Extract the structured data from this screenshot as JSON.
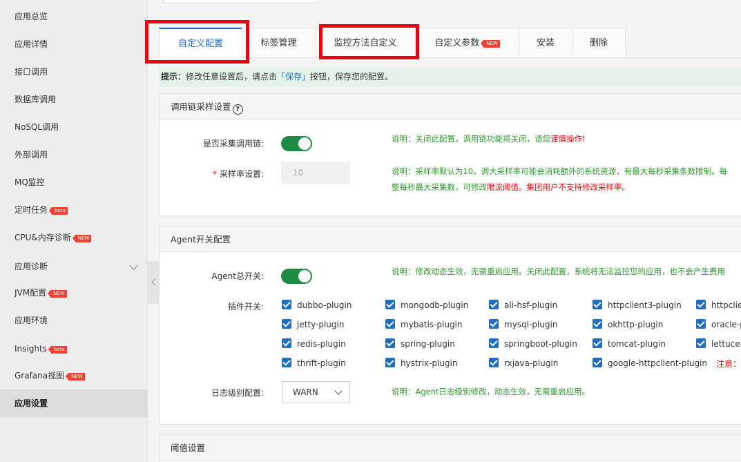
{
  "sidebar": {
    "items": [
      {
        "label": "应用总览"
      },
      {
        "label": "应用详情"
      },
      {
        "label": "接口调用"
      },
      {
        "label": "数据库调用"
      },
      {
        "label": "NoSQL调用"
      },
      {
        "label": "外部调用"
      },
      {
        "label": "MQ监控"
      },
      {
        "label": "定时任务",
        "badge": "beta"
      },
      {
        "label": "CPU&内存诊断",
        "badge": "NEW"
      },
      {
        "label": "应用诊断"
      },
      {
        "label": "JVM配置",
        "badge": "NEW"
      },
      {
        "label": "应用环境"
      },
      {
        "label": "Insights",
        "badge": "beta"
      },
      {
        "label": "Grafana视图",
        "badge": "NEW"
      },
      {
        "label": "应用设置"
      }
    ]
  },
  "tabs": [
    {
      "label": "自定义配置"
    },
    {
      "label": "标签管理"
    },
    {
      "label": "监控方法自定义"
    },
    {
      "label": "自定义参数",
      "badge": "NEW"
    },
    {
      "label": "安装"
    },
    {
      "label": "删除"
    }
  ],
  "tip": {
    "prefix": "提示：",
    "text1": "修改任意设置后，请点击",
    "link": "「保存」",
    "text2": "按钮，保存您的配置。"
  },
  "trace_panel": {
    "title": "调用链采样设置",
    "help_icon": "?",
    "collect_label": "是否采集调用链:",
    "collect_note_1": "说明：关闭此配置，调用链功能将关闭，请您",
    "collect_note_warn": "谨慎操作!",
    "sample_label": "采样率设置:",
    "sample_value": "10",
    "sample_note_line1": "说明：采样率默认为10。调大采样率可能会消耗额外的系统资源，有最大每秒采集条数限制。每",
    "sample_note_line2a": "整每秒最大采集数，可修改",
    "sample_note_line2b": "限流阈值。集团用户不支持修改采样率。"
  },
  "agent_panel": {
    "title": "Agent开关配置",
    "switch_label": "Agent总开关:",
    "switch_note": "说明：修改动态生效，无需重启应用。关闭此配置，系统将无法监控您的应用，也不会产生费用",
    "plugin_label": "插件开关:",
    "plugins": [
      "dubbo-plugin",
      "mongodb-plugin",
      "ali-hsf-plugin",
      "httpclient3-plugin",
      "httpclier",
      "jetty-plugin",
      "mybatis-plugin",
      "mysql-plugin",
      "okhttp-plugin",
      "oracle-p",
      "redis-plugin",
      "spring-plugin",
      "springboot-plugin",
      "tomcat-plugin",
      "lettuce-p",
      "thrift-plugin",
      "hystrix-plugin",
      "rxjava-plugin",
      "google-httpclient-plugin"
    ],
    "plugin_warn": "注意：",
    "log_label": "日志级别配置:",
    "log_value": "WARN",
    "log_note": "说明：Agent日志级别修改，动态生效，无需重启应用。"
  },
  "threshold_panel": {
    "title": "阈值设置"
  }
}
